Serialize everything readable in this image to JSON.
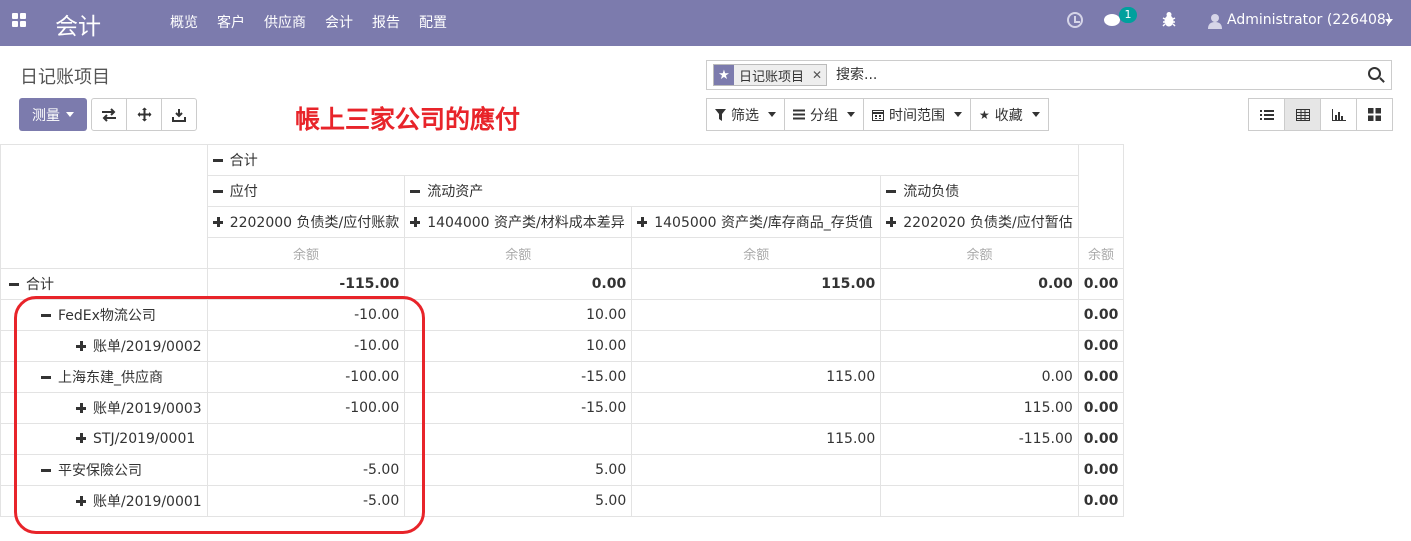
{
  "app_title": "会计",
  "menu": [
    "概览",
    "客户",
    "供应商",
    "会计",
    "报告",
    "配置"
  ],
  "nav": {
    "chat_badge": "1",
    "user": "Administrator (226408)"
  },
  "breadcrumb": "日记账项目",
  "measure_label": "测量",
  "annotation": "帳上三家公司的應付",
  "search": {
    "facet": "日记账项目",
    "placeholder": "搜索..."
  },
  "filters": {
    "filter": "筛选",
    "group": "分组",
    "time_range": "时间范围",
    "favorites": "收藏"
  },
  "pivot": {
    "col_total": "合计",
    "col_groups": [
      "应付",
      "流动资产",
      "流动负债"
    ],
    "accounts": [
      "2202000 负债类/应付账款",
      "1404000 资产类/材料成本差异",
      "1405000 资产类/库存商品_存货值",
      "2202020 负债类/应付暂估"
    ],
    "measure": "余额",
    "rows": [
      {
        "label": "合计",
        "level": 0,
        "icon": "minus",
        "values": [
          "-115.00",
          "0.00",
          "115.00",
          "0.00",
          "0.00"
        ]
      },
      {
        "label": "FedEx物流公司",
        "level": 1,
        "icon": "minus",
        "values": [
          "-10.00",
          "10.00",
          "",
          "",
          "0.00"
        ]
      },
      {
        "label": "账单/2019/0002",
        "level": 2,
        "icon": "plus",
        "values": [
          "-10.00",
          "10.00",
          "",
          "",
          "0.00"
        ]
      },
      {
        "label": "上海东建_供应商",
        "level": 1,
        "icon": "minus",
        "values": [
          "-100.00",
          "-15.00",
          "115.00",
          "0.00",
          "0.00"
        ]
      },
      {
        "label": "账单/2019/0003",
        "level": 2,
        "icon": "plus",
        "values": [
          "-100.00",
          "-15.00",
          "",
          "115.00",
          "0.00"
        ]
      },
      {
        "label": "STJ/2019/0001",
        "level": 2,
        "icon": "plus",
        "values": [
          "",
          "",
          "115.00",
          "-115.00",
          "0.00"
        ]
      },
      {
        "label": "平安保險公司",
        "level": 1,
        "icon": "minus",
        "values": [
          "-5.00",
          "5.00",
          "",
          "",
          "0.00"
        ]
      },
      {
        "label": "账单/2019/0001",
        "level": 2,
        "icon": "plus",
        "values": [
          "-5.00",
          "5.00",
          "",
          "",
          "0.00"
        ]
      }
    ]
  },
  "colors": {
    "navbar": "#7c7bad",
    "annotation": "#e8242a",
    "badge": "#00a09d"
  }
}
